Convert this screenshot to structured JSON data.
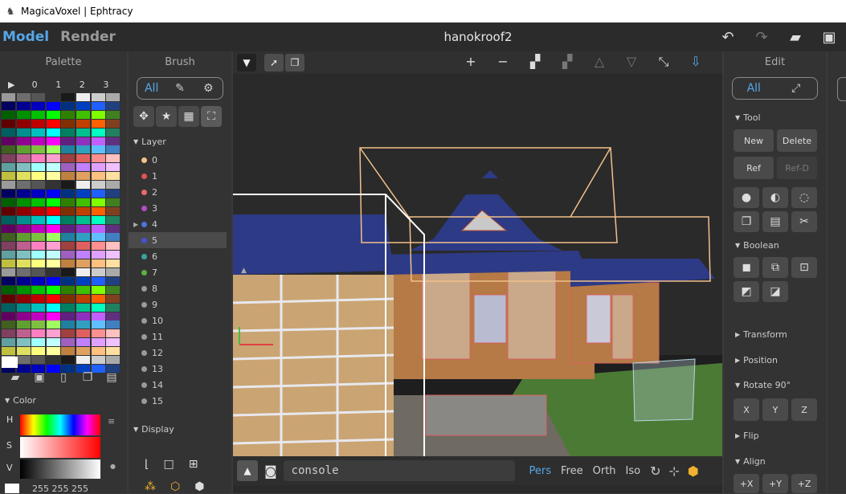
{
  "window": {
    "title": "MagicaVoxel | Ephtracy",
    "icon": "magicavoxel-app-icon"
  },
  "topbar": {
    "mode_model": "Model",
    "mode_render": "Render",
    "file_title": "hanokroof2",
    "icons": [
      "undo-icon",
      "redo-icon",
      "open-folder-icon",
      "save-icon"
    ]
  },
  "palette": {
    "title": "Palette",
    "header": [
      "▶",
      "0",
      "1",
      "2",
      "3"
    ],
    "icons": [
      "open-folder-icon",
      "save-icon",
      "new-file-icon",
      "copy-icon",
      "paste-icon"
    ],
    "color_section": "Color",
    "labels": {
      "h": "H",
      "s": "S",
      "v": "V"
    },
    "rgb": "255 255 255"
  },
  "brush": {
    "title": "Brush",
    "seg_all": "All",
    "layer_section": "Layer",
    "display_section": "Display",
    "layers": [
      {
        "label": "0",
        "color": "#f4c28a"
      },
      {
        "label": "1",
        "color": "#e25353"
      },
      {
        "label": "2",
        "color": "#e86a6a"
      },
      {
        "label": "3",
        "color": "#b34fc2"
      },
      {
        "label": "4",
        "color": "#4a74d9"
      },
      {
        "label": "5",
        "color": "#4a4fcf"
      },
      {
        "label": "6",
        "color": "#3aa39c"
      },
      {
        "label": "7",
        "color": "#5cb042"
      },
      {
        "label": "8",
        "color": "#9a9a9a"
      },
      {
        "label": "9",
        "color": "#9a9a9a"
      },
      {
        "label": "10",
        "color": "#9a9a9a"
      },
      {
        "label": "11",
        "color": "#9a9a9a"
      },
      {
        "label": "12",
        "color": "#9a9a9a"
      },
      {
        "label": "13",
        "color": "#9a9a9a"
      },
      {
        "label": "14",
        "color": "#9a9a9a"
      },
      {
        "label": "15",
        "color": "#9a9a9a"
      }
    ],
    "selected_layer": "5"
  },
  "edit": {
    "title": "Edit",
    "seg_all": "All",
    "tool_section": "Tool",
    "boolean_section": "Boolean",
    "new": "New",
    "delete": "Delete",
    "ref": "Ref",
    "refd": "Ref-D",
    "transform": "Transform",
    "position": "Position",
    "rotate": "Rotate 90°",
    "flip": "Flip",
    "align": "Align",
    "x": "X",
    "y": "Y",
    "z": "Z",
    "px": "+X",
    "py": "+Y",
    "pz": "+Z"
  },
  "viewport": {
    "console_placeholder": "console",
    "cams": [
      "Pers",
      "Free",
      "Orth",
      "Iso"
    ],
    "active_cam": "Pers"
  },
  "colors": {
    "accent": "#55a7e8",
    "panel": "#333333",
    "button": "#4a4a4a"
  }
}
